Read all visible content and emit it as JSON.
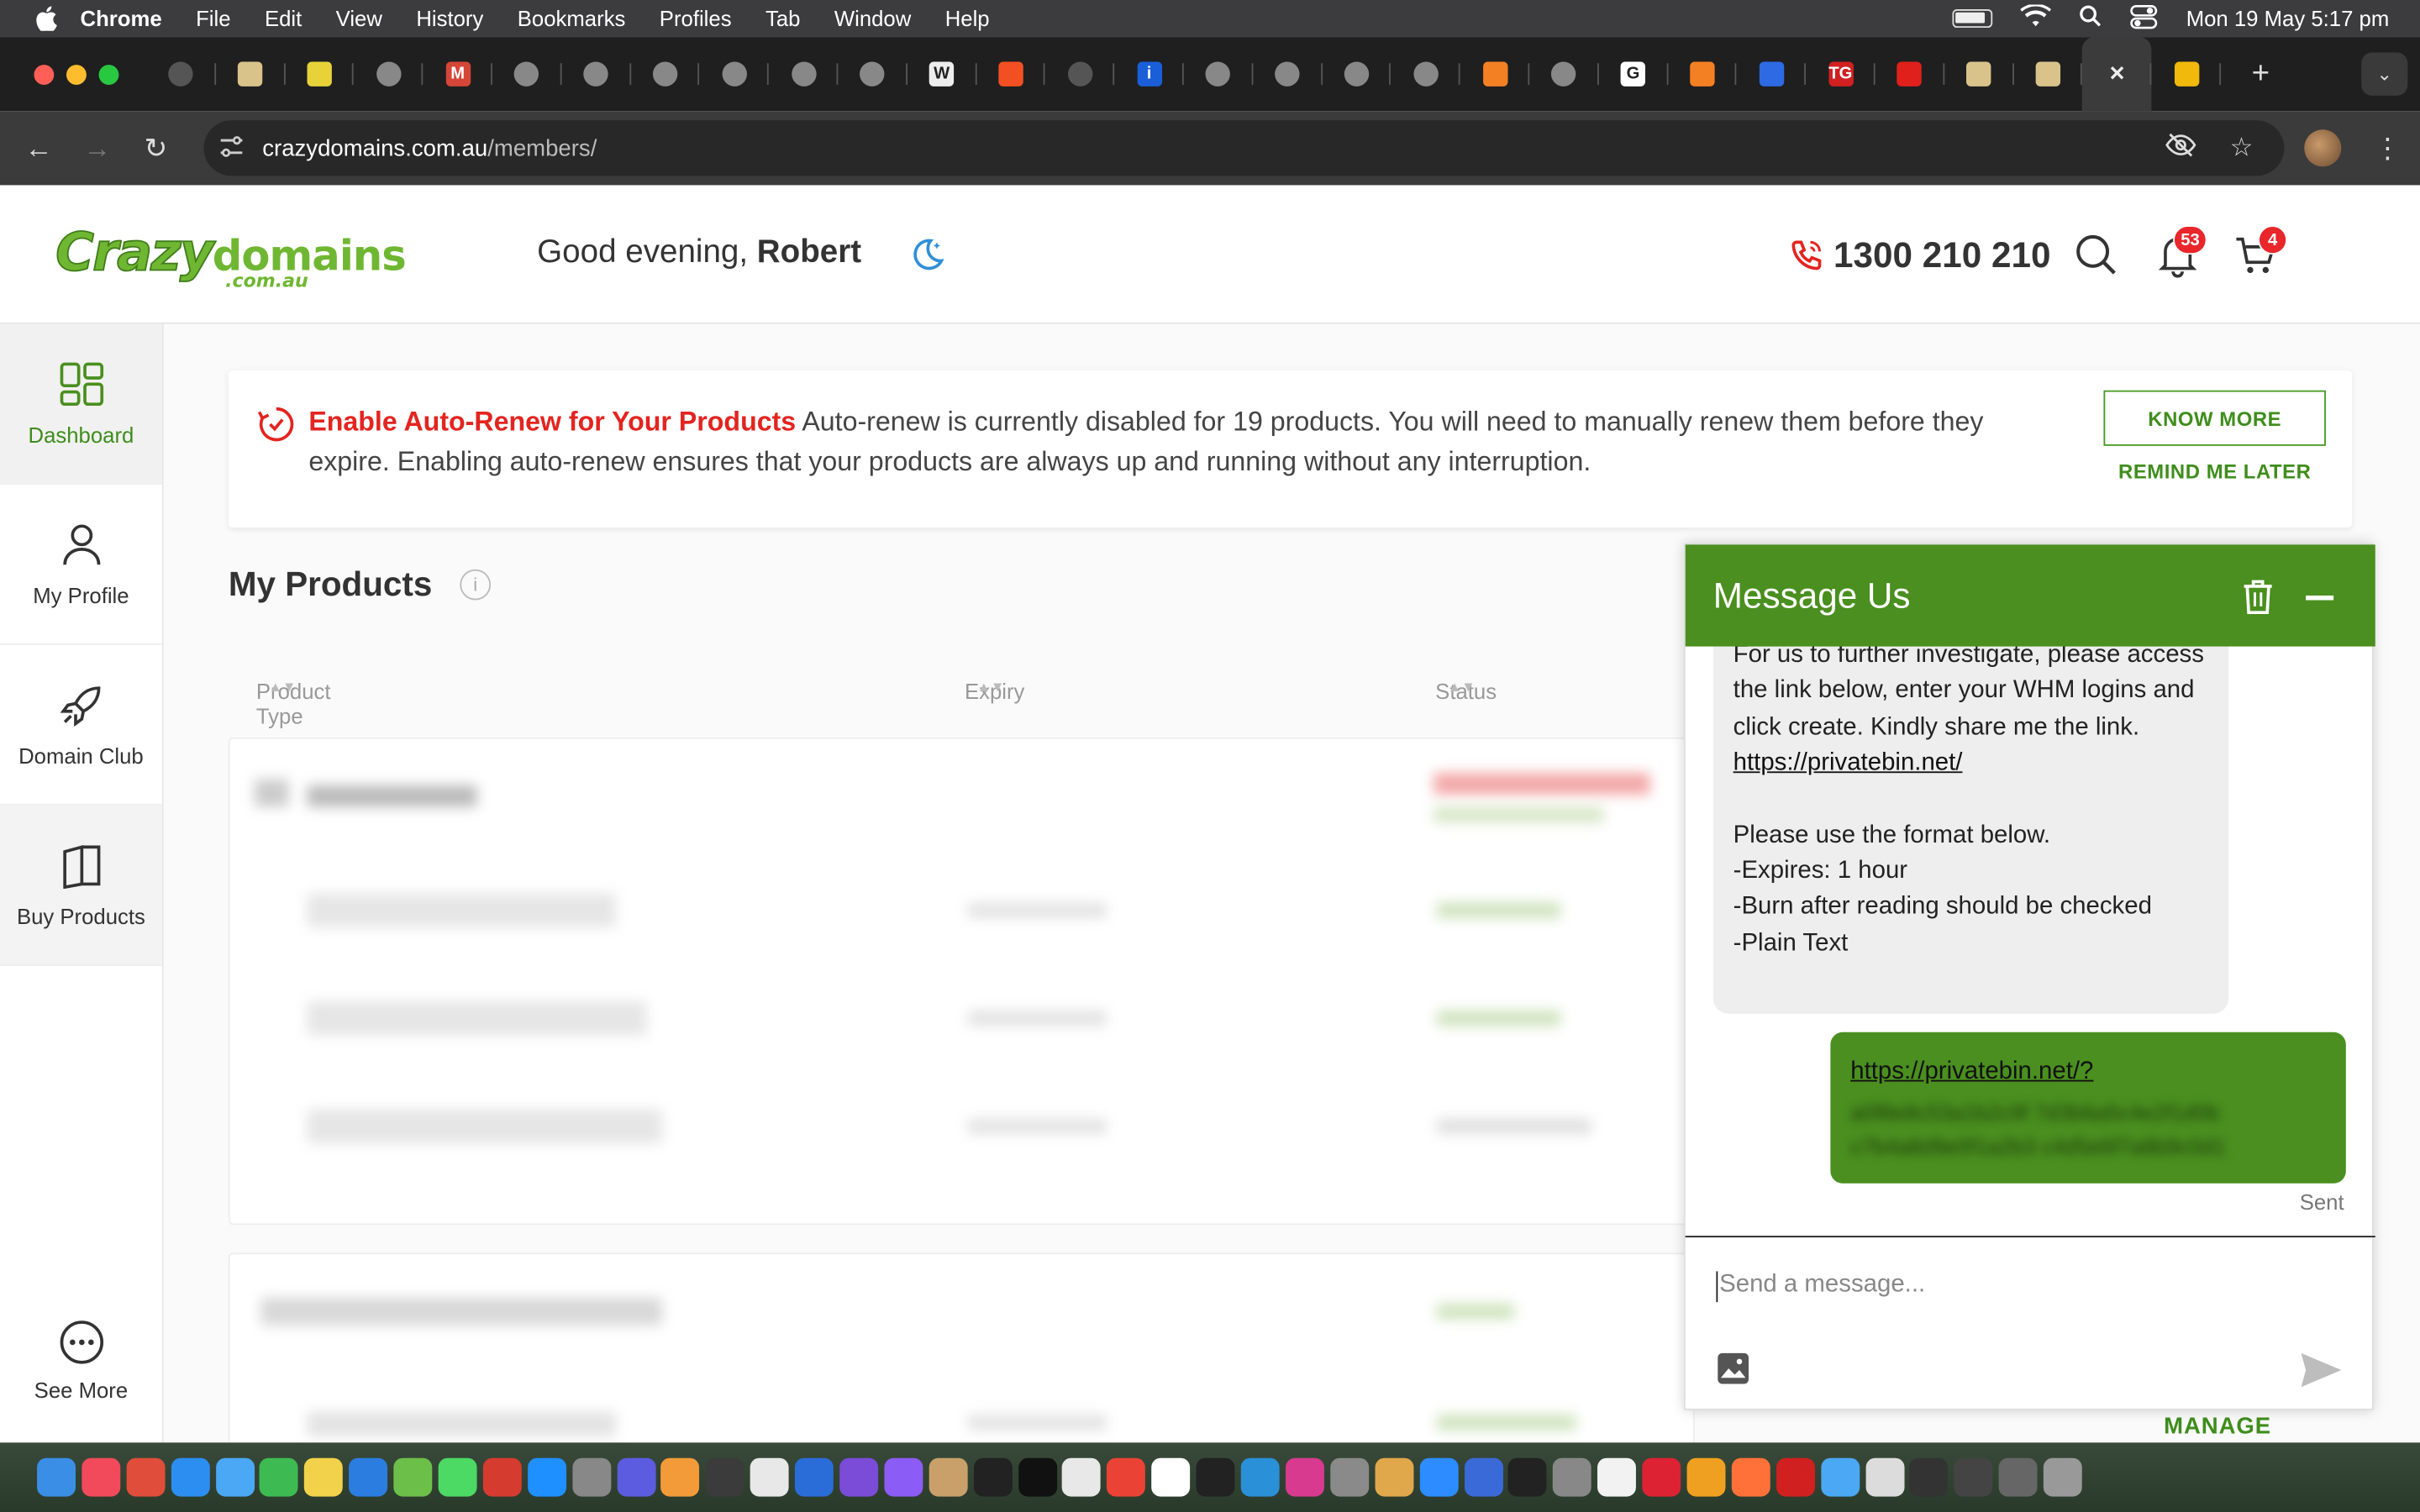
{
  "menubar": {
    "app": "Chrome",
    "items": [
      "File",
      "Edit",
      "View",
      "History",
      "Bookmarks",
      "Profiles",
      "Tab",
      "Window",
      "Help"
    ],
    "clock": "Mon 19 May  5:17 pm"
  },
  "tabs": {
    "favicons": [
      {
        "icon": "chrome-icon",
        "color": "#555"
      },
      {
        "icon": "notes-icon",
        "color": "#d9c38a"
      },
      {
        "icon": "loading-icon",
        "color": "#e8d23a"
      },
      {
        "icon": "crazydomains-icon",
        "color": "#888"
      },
      {
        "icon": "gmail-icon",
        "color": "#d44638",
        "text": "M"
      },
      {
        "icon": "crazydomains-icon",
        "color": "#888"
      },
      {
        "icon": "crazydomains-icon",
        "color": "#888"
      },
      {
        "icon": "crazydomains-icon",
        "color": "#888"
      },
      {
        "icon": "crazydomains-icon",
        "color": "#888"
      },
      {
        "icon": "crazydomains-icon",
        "color": "#888"
      },
      {
        "icon": "crazydomains-icon",
        "color": "#888"
      },
      {
        "icon": "wikipedia-icon",
        "color": "#eee",
        "text": "W"
      },
      {
        "icon": "microsoft-icon",
        "color": "#f25022"
      },
      {
        "icon": "chrome-icon",
        "color": "#555"
      },
      {
        "icon": "info-icon",
        "color": "#1a5fd8",
        "text": "i"
      },
      {
        "icon": "crazydomains-icon",
        "color": "#888"
      },
      {
        "icon": "crazydomains-icon",
        "color": "#888"
      },
      {
        "icon": "crazydomains-icon",
        "color": "#888"
      },
      {
        "icon": "crazydomains-icon",
        "color": "#888"
      },
      {
        "icon": "stackoverflow-icon",
        "color": "#f48024"
      },
      {
        "icon": "crazydomains-icon",
        "color": "#888"
      },
      {
        "icon": "google-icon",
        "color": "#fff",
        "text": "G"
      },
      {
        "icon": "stackoverflow-icon",
        "color": "#f48024"
      },
      {
        "icon": "zb-icon",
        "color": "#2d6ae3"
      },
      {
        "icon": "tg-icon",
        "color": "#d02020",
        "text": "TG"
      },
      {
        "icon": "acrobat-icon",
        "color": "#e0201b"
      },
      {
        "icon": "notes-icon",
        "color": "#d9c38a"
      },
      {
        "icon": "notes-icon",
        "color": "#d9c38a"
      },
      {
        "icon": "close-icon",
        "color": "#3b3b3b",
        "text": "✕"
      },
      {
        "icon": "binance-icon",
        "color": "#f0b90b"
      }
    ]
  },
  "toolbar": {
    "url_host": "crazydomains.com.au",
    "url_path": "/members/"
  },
  "header": {
    "logo_main": "Crazy",
    "logo_second": "domains",
    "logo_sub": ".com.au",
    "greeting_prefix": "Good evening, ",
    "greeting_name": "Robert",
    "phone": "1300 210 210",
    "notifications_count": "53",
    "cart_count": "4"
  },
  "sidebar": {
    "items": [
      {
        "label": "Dashboard",
        "icon": "dashboard-icon"
      },
      {
        "label": "My Profile",
        "icon": "user-icon"
      },
      {
        "label": "Domain Club",
        "icon": "rocket-icon"
      },
      {
        "label": "Buy Products",
        "icon": "book-icon"
      }
    ],
    "see_more": "See More"
  },
  "banner": {
    "title": "Enable Auto-Renew for Your Products",
    "body": " Auto-renew is currently disabled for 19 products. You will need to manually renew them before they expire. Enabling auto-renew ensures that your products are always up and running without any interruption.",
    "know_more": "KNOW MORE",
    "remind_later": "REMIND ME LATER"
  },
  "products": {
    "title": "My Products",
    "columns": [
      "Product Type",
      "Expiry",
      "Status"
    ],
    "manage_label": "MANAGE"
  },
  "chat": {
    "title": "Message Us",
    "incoming": {
      "line1": "For us to further investigate, please access the link below, enter your WHM logins and click create. Kindly share me the link.",
      "link": "https://privatebin.net/",
      "line2": "Please use the format below.",
      "line3": "-Expires: 1 hour",
      "line4": "-Burn after reading should be checked",
      "line5": "-Plain Text"
    },
    "outgoing_link": "https://privatebin.net/?",
    "status": "Sent",
    "input_placeholder": "Send a message..."
  },
  "colors": {
    "brand_green": "#4a8f1f",
    "alert_red": "#e3241f",
    "badge_red": "#e8262b"
  }
}
